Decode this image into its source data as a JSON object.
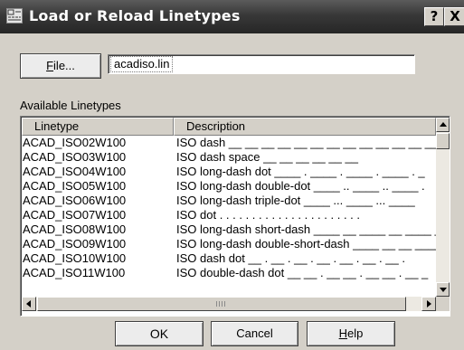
{
  "window": {
    "title": "Load or Reload Linetypes",
    "help_glyph": "?",
    "close_glyph": "X"
  },
  "file": {
    "button_label": "File...",
    "button_mnemonic": "F",
    "button_rest": "ile...",
    "value": "acadiso.lin"
  },
  "available_label": "Available Linetypes",
  "table": {
    "columns": [
      "Linetype",
      "Description"
    ],
    "rows": [
      {
        "name": "ACAD_ISO02W100",
        "desc": "ISO dash __ __ __ __ __ __ __ __ __ __ __ __ __"
      },
      {
        "name": "ACAD_ISO03W100",
        "desc": "ISO dash space __    __    __    __    __    __"
      },
      {
        "name": "ACAD_ISO04W100",
        "desc": "ISO long-dash dot ____ . ____ . ____ . ____ . _"
      },
      {
        "name": "ACAD_ISO05W100",
        "desc": "ISO long-dash double-dot ____ .. ____ .. ____ ."
      },
      {
        "name": "ACAD_ISO06W100",
        "desc": "ISO long-dash triple-dot ____ ... ____ ... ____"
      },
      {
        "name": "ACAD_ISO07W100",
        "desc": "ISO dot . . . . . . . . . . . . . . . . . . . . . ."
      },
      {
        "name": "ACAD_ISO08W100",
        "desc": "ISO long-dash short-dash ____ __ ____ __ ____ _"
      },
      {
        "name": "ACAD_ISO09W100",
        "desc": "ISO long-dash double-short-dash ____ __ __ ____"
      },
      {
        "name": "ACAD_ISO10W100",
        "desc": "ISO dash dot __ . __ . __ . __ . __ . __ . __ ."
      },
      {
        "name": "ACAD_ISO11W100",
        "desc": "ISO double-dash dot __ __ . __ __ . __ __ . __ _"
      }
    ]
  },
  "buttons": {
    "ok": "OK",
    "cancel": "Cancel",
    "help": "Help",
    "help_mnemonic": "H",
    "help_rest": "elp"
  }
}
